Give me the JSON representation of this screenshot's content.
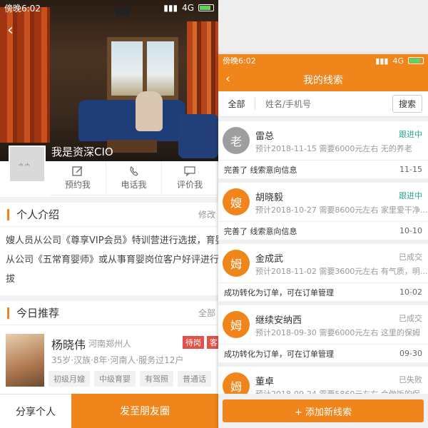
{
  "left": {
    "status": {
      "time": "傍晚6:02",
      "network": "4G"
    },
    "profile_name": "我是资深CIO",
    "avatar_text": "ሐ ሐ",
    "actions": [
      "预约我",
      "电话我",
      "评价我"
    ],
    "intro": {
      "title": "个人介绍",
      "more": "修改",
      "lines": [
        "嫂人员从公司《尊享VIP会员》特训营进行选拔，育婴",
        "从公司《五常育婴师》或从事育婴岗位客户好评进行",
        "拔"
      ]
    },
    "recommend": {
      "title": "今日推荐",
      "more": "全部"
    },
    "nanny": {
      "name": "杨晓伟",
      "location": "河南郑州人",
      "tag1": "待岗",
      "tag2": "客",
      "info": "35岁·汉族·8年·河南人·服务过12户",
      "chips": [
        "初级月嫂",
        "中级育婴",
        "有驾照",
        "普通话"
      ]
    },
    "bottom": {
      "share": "分享个人",
      "moments": "发至朋友圈"
    }
  },
  "right": {
    "status": {
      "time": "傍晚6:02",
      "network": "4G"
    },
    "title": "我的线索",
    "filter_all": "全部",
    "search_placeholder": "姓名/手机号",
    "search_button": "搜索",
    "leads": [
      {
        "avatar": "老",
        "color": "#9e9e9e",
        "name": "雷总",
        "status": "跟进中",
        "status_color": "#2aa88f",
        "sub": "预计2018-11-15 需要6000元左右 无的养老",
        "action": "完善了 线索意向信息",
        "date": "11-15"
      },
      {
        "avatar": "嫂",
        "color": "#f0851b",
        "name": "胡晓毅",
        "status": "跟进中",
        "status_color": "#2aa88f",
        "sub": "预计2018-10-27 需要8600元左右 家里爱干净...",
        "action": "完善了 线索意向信息",
        "date": "10-10"
      },
      {
        "avatar": "姆",
        "color": "#f0851b",
        "name": "金成武",
        "status": "已成交",
        "status_color": "#999999",
        "sub": "预计2018-11-02 需要3600元左右 有气质，明...",
        "action": "成功转化为订单，可在订单管理",
        "date": "10-02"
      },
      {
        "avatar": "姆",
        "color": "#f0851b",
        "name": "继续安纳西",
        "status": "已成交",
        "status_color": "#999999",
        "sub": "预计2018-09-30 需要6000元左右 这里的保姆",
        "action": "成功转化为订单，可在订单管理",
        "date": "09-30"
      },
      {
        "avatar": "姆",
        "color": "#f0851b",
        "name": "董卓",
        "status": "已失败",
        "status_color": "#999999",
        "sub": "预计2018-09-24 需要5860元左右 会做饭的保..."
      }
    ],
    "add_button": "+ 添加新线索"
  }
}
